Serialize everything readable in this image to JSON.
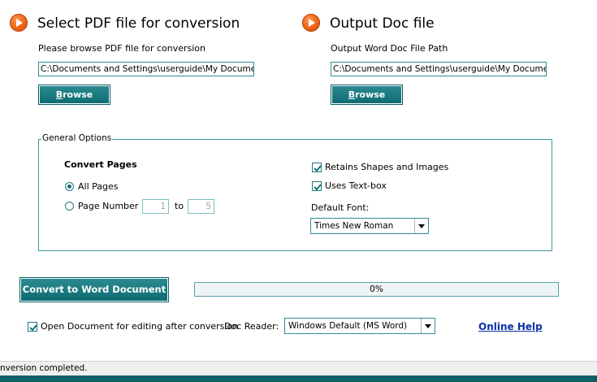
{
  "input_section": {
    "title": "Select PDF file for conversion",
    "label": "Please browse PDF file for conversion",
    "path_value": "C:\\Documents and Settings\\userguide\\My Documents\\",
    "browse_label_first": "B",
    "browse_label_rest": "rowse"
  },
  "output_section": {
    "title": "Output Doc file",
    "label": "Output Word Doc File Path",
    "path_value": "C:\\Documents and Settings\\userguide\\My Documents\\",
    "browse_label_first": "B",
    "browse_label_rest": "rowse"
  },
  "general_options": {
    "legend": "General Options",
    "convert_pages_title": "Convert Pages",
    "all_pages_label": "All Pages",
    "all_pages_selected": true,
    "page_number_label": "Page Number",
    "page_number_selected": false,
    "page_from": "1",
    "to_label": "to",
    "page_to": "5",
    "retains_shapes_label": "Retains Shapes and Images",
    "retains_shapes_checked": true,
    "uses_textbox_label": "Uses Text-box",
    "uses_textbox_checked": true,
    "default_font_label": "Default Font:",
    "default_font_value": "Times New Roman"
  },
  "convert": {
    "button_label": "Convert to Word Document",
    "progress_text": "0%",
    "progress_value": 0
  },
  "footer_options": {
    "open_document_label": "Open Document for editing after conversion",
    "open_document_checked": true,
    "doc_reader_label": "Doc Reader:",
    "doc_reader_value": "Windows Default (MS Word)",
    "online_help_label": "Online Help"
  },
  "status": {
    "text": "nversion completed."
  },
  "colors": {
    "accent": "#0c6a71",
    "play_icon": "#f06a1a",
    "link": "#0b2fa8"
  },
  "icons": [
    "play-circle-icon",
    "checkmark-icon",
    "chevron-down-icon"
  ]
}
